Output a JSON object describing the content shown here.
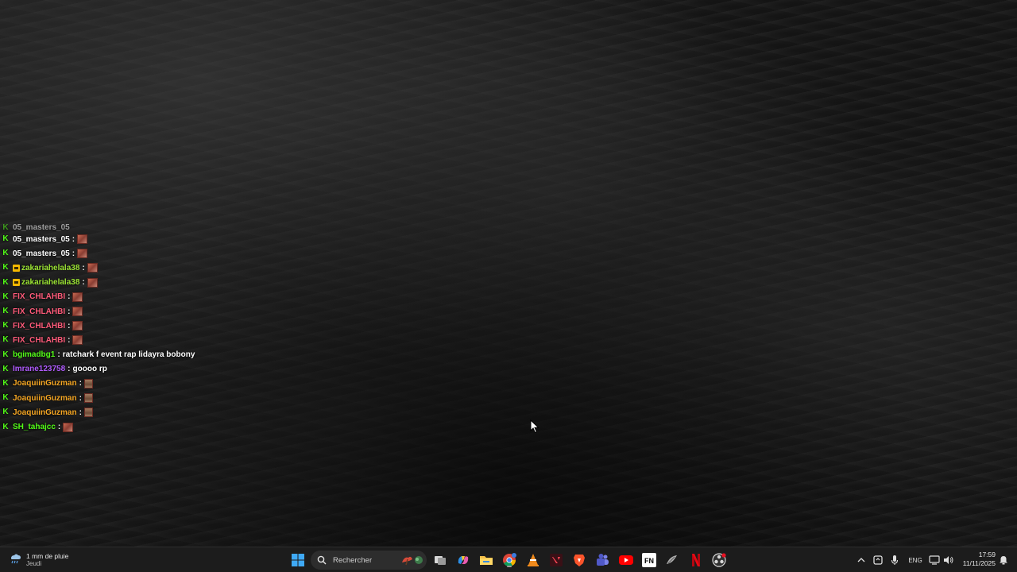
{
  "chat": {
    "partial_top": {
      "username": "05_masters_05",
      "color": "#ffffff"
    },
    "messages": [
      {
        "username": "05_masters_05",
        "color": "#ffffff",
        "sub": false,
        "emote": "red",
        "text": ""
      },
      {
        "username": "05_masters_05",
        "color": "#ffffff",
        "sub": false,
        "emote": "red",
        "text": ""
      },
      {
        "username": "zakariahelala38",
        "color": "#9be334",
        "sub": true,
        "emote": "red",
        "text": ""
      },
      {
        "username": "zakariahelala38",
        "color": "#9be334",
        "sub": true,
        "emote": "red",
        "text": ""
      },
      {
        "username": "FIX_CHLAHBI",
        "color": "#ff5b7a",
        "sub": false,
        "emote": "red",
        "text": ""
      },
      {
        "username": "FIX_CHLAHBI",
        "color": "#ff5b7a",
        "sub": false,
        "emote": "red",
        "text": ""
      },
      {
        "username": "FIX_CHLAHBI",
        "color": "#ff5b7a",
        "sub": false,
        "emote": "red",
        "text": ""
      },
      {
        "username": "FIX_CHLAHBI",
        "color": "#ff5b7a",
        "sub": false,
        "emote": "red",
        "text": ""
      },
      {
        "username": "bgimadbg1",
        "color": "#53fc18",
        "sub": false,
        "emote": "",
        "text": "ratchark f event rap lidayra bobony"
      },
      {
        "username": "Imrane123758",
        "color": "#b05bff",
        "sub": false,
        "emote": "",
        "text": "goooo rp"
      },
      {
        "username": "JoaquiinGuzman",
        "color": "#f5a623",
        "sub": false,
        "emote": "brown",
        "text": ""
      },
      {
        "username": "JoaquiinGuzman",
        "color": "#f5a623",
        "sub": false,
        "emote": "brown",
        "text": ""
      },
      {
        "username": "JoaquiinGuzman",
        "color": "#f5a623",
        "sub": false,
        "emote": "brown",
        "text": ""
      },
      {
        "username": "SH_tahajcc",
        "color": "#53fc18",
        "sub": false,
        "emote": "red",
        "text": ""
      }
    ],
    "separator": ":"
  },
  "taskbar": {
    "weather": {
      "line1": "1 mm de pluie",
      "line2": "Jeudi",
      "icon": "rain-cloud-icon"
    },
    "search": {
      "placeholder": "Rechercher"
    },
    "pinned": [
      "start-icon",
      "task-view-icon",
      "copilot-icon",
      "file-explorer-icon",
      "chrome-icon",
      "vlc-icon",
      "valorant-icon",
      "brave-icon",
      "teams-icon",
      "youtube-icon",
      "fn-icon",
      "pen-tool-icon",
      "netflix-icon",
      "obs-icon"
    ],
    "tray": {
      "language": "ENG",
      "time": "17:59",
      "date": "11/11/2025"
    }
  },
  "colors": {
    "kick_green": "#53fc18",
    "taskbar_bg": "#1c1c1c"
  }
}
